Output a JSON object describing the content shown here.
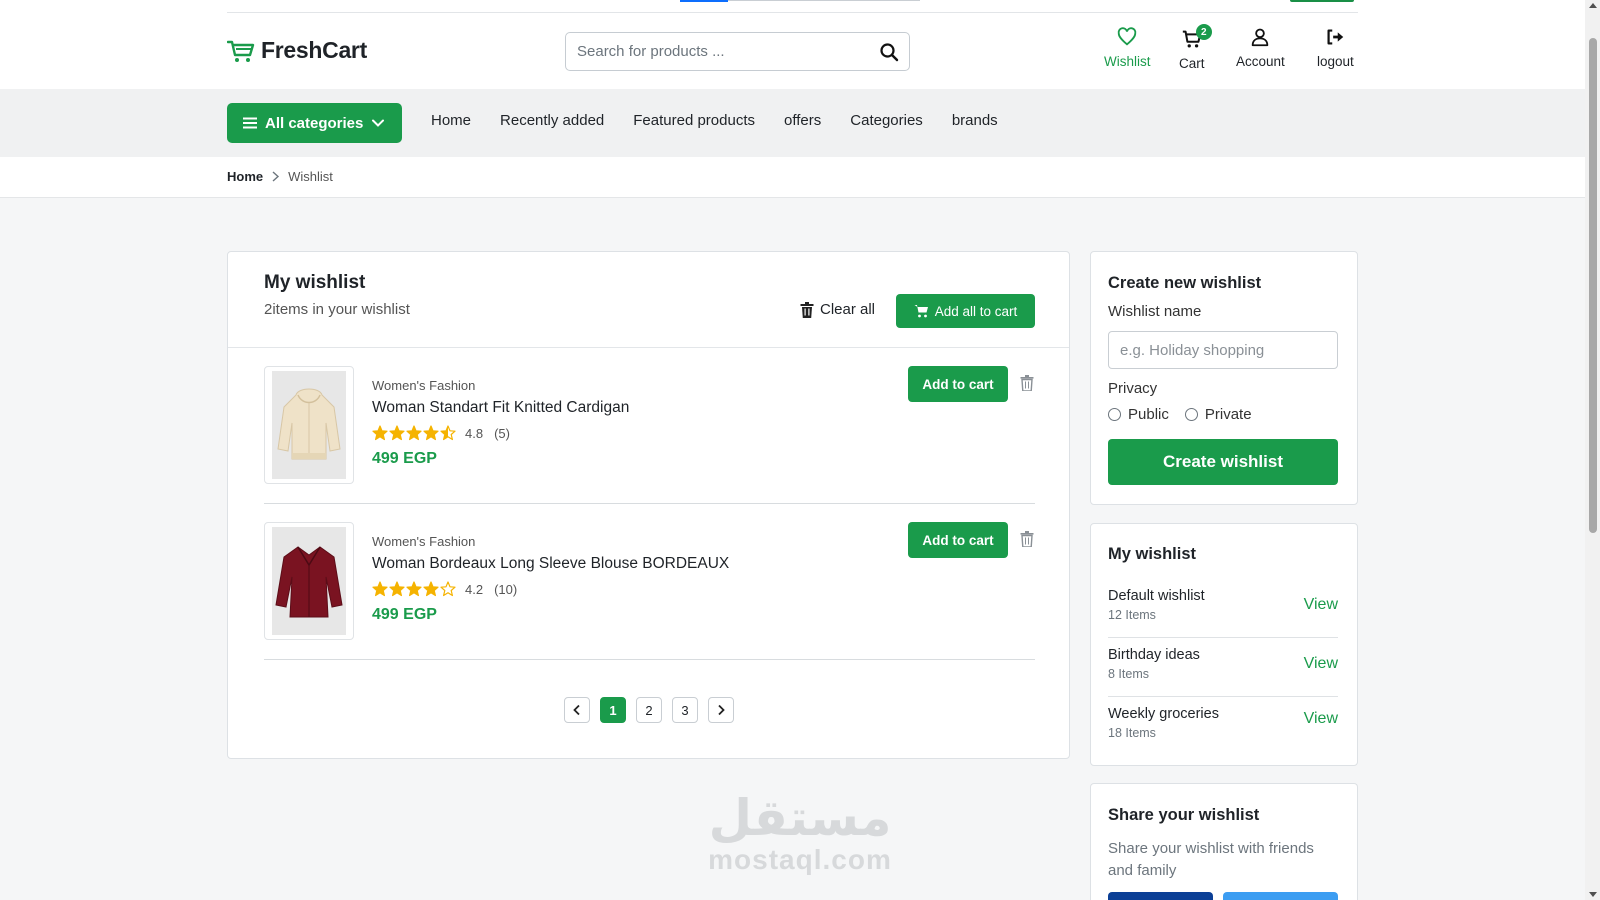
{
  "brand": {
    "name": "FreshCart",
    "accent": "#1a9b4b"
  },
  "search": {
    "placeholder": "Search for products ..."
  },
  "header_nav": {
    "wishlist": "Wishlist",
    "cart": "Cart",
    "cart_count": "2",
    "account": "Account",
    "logout": "logout"
  },
  "category_bar": {
    "all_categories": "All categories",
    "links": [
      "Home",
      "Recently added",
      "Featured products",
      "offers",
      "Categories",
      "brands"
    ]
  },
  "breadcrumb": {
    "home": "Home",
    "current": "Wishlist"
  },
  "wishlist": {
    "title": "My wishlist",
    "subtitle": "2items in your wishlist",
    "clear_all": "Clear all",
    "add_all": "Add all to cart",
    "items": [
      {
        "category": "Women's Fashion",
        "name": "Woman Standart Fit Knitted Cardigan",
        "rating": "4.8",
        "reviews": "(5)",
        "price": "499 EGP",
        "add_label": "Add to cart",
        "image_icon": "cardigan-icon",
        "stars": 4.5
      },
      {
        "category": "Women's Fashion",
        "name": "Woman Bordeaux Long Sleeve Blouse BORDEAUX",
        "rating": "4.2",
        "reviews": "(10)",
        "price": "499 EGP",
        "add_label": "Add to cart",
        "image_icon": "blouse-icon",
        "stars": 4
      }
    ],
    "pagination": {
      "pages": [
        "1",
        "2",
        "3"
      ],
      "current": "1"
    }
  },
  "create_wishlist": {
    "title": "Create new wishlist",
    "name_label": "Wishlist name",
    "name_placeholder": "e.g. Holiday shopping",
    "privacy_label": "Privacy",
    "public": "Public",
    "private": "Private",
    "button": "Create wishlist"
  },
  "my_wishlists": {
    "title": "My wishlist",
    "lists": [
      {
        "name": "Default wishlist",
        "count": "12 Items",
        "action": "View"
      },
      {
        "name": "Birthday ideas",
        "count": "8 Items",
        "action": "View"
      },
      {
        "name": "Weekly groceries",
        "count": "18 Items",
        "action": "View"
      }
    ]
  },
  "share": {
    "title": "Share your wishlist",
    "subtitle": "Share your wishlist with friends and family"
  },
  "watermark": {
    "arabic": "مستقل",
    "latin": "mostaql.com"
  }
}
